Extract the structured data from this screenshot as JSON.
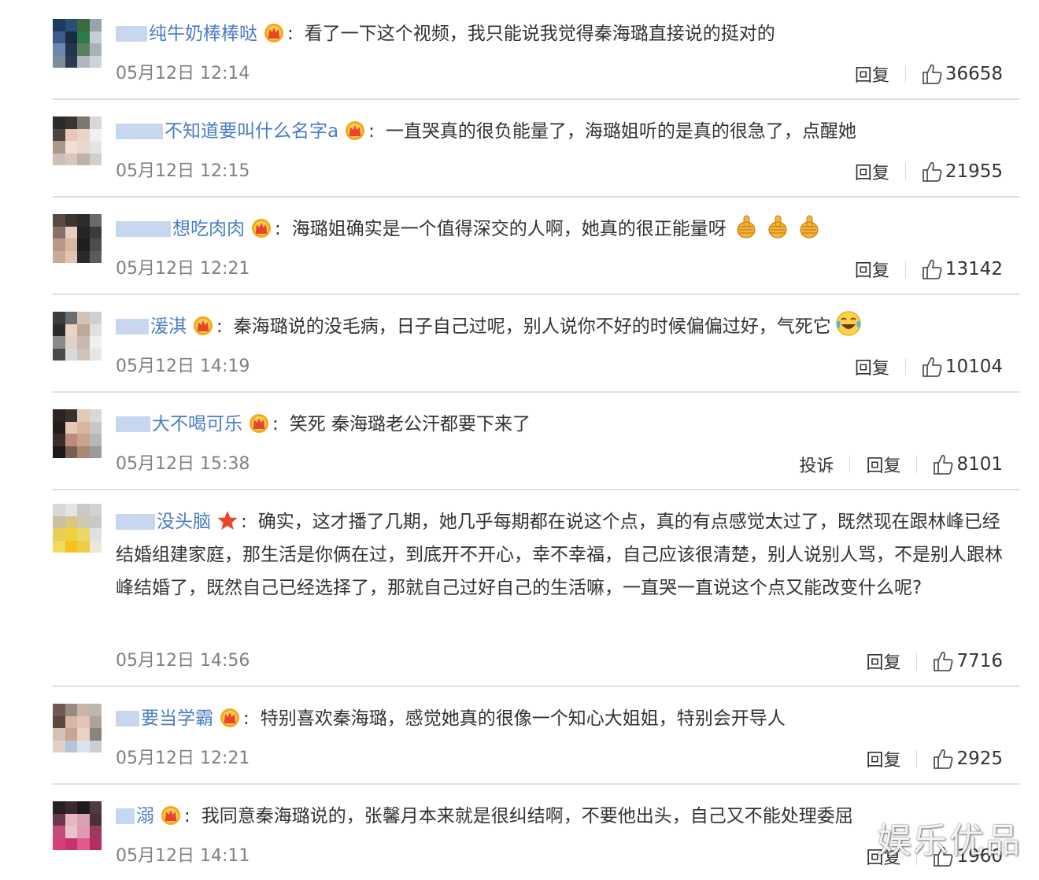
{
  "comments": [
    {
      "user": "纯牛奶棒棒哒",
      "badge": "crown",
      "text": "看了一下这个视频，我只能说我觉得秦海璐直接说的挺对的",
      "emojis": [],
      "time": "05月12日 12:14",
      "report": "",
      "reply": "回复",
      "likes": "36658"
    },
    {
      "user": "不知道要叫什么名字a",
      "badge": "crown",
      "text": "一直哭真的很负能量了，海璐姐听的是真的很急了，点醒她",
      "emojis": [],
      "time": "05月12日 12:15",
      "report": "",
      "reply": "回复",
      "likes": "21955"
    },
    {
      "user": "想吃肉肉",
      "badge": "crown",
      "text": "海璐姐确实是一个值得深交的人啊，她真的很正能量呀",
      "emojis": [
        "thumbs-up",
        "thumbs-up",
        "thumbs-up"
      ],
      "time": "05月12日 12:21",
      "report": "",
      "reply": "回复",
      "likes": "13142"
    },
    {
      "user": "湲淇",
      "badge": "crown",
      "text": "秦海璐说的没毛病，日子自己过呢，别人说你不好的时候偏偏过好，气死它",
      "emojis": [
        "laugh-cry"
      ],
      "time": "05月12日 14:19",
      "report": "",
      "reply": "回复",
      "likes": "10104"
    },
    {
      "user": "大不喝可乐",
      "badge": "crown",
      "text": "笑死 秦海璐老公汗都要下来了",
      "emojis": [],
      "time": "05月12日 15:38",
      "report": "投诉",
      "reply": "回复",
      "likes": "8101"
    },
    {
      "user": "没头脑",
      "badge": "star",
      "text": "确实，这才播了几期，她几乎每期都在说这个点，真的有点感觉太过了，既然现在跟林峰已经结婚组建家庭，那生活是你俩在过，到底开不开心，幸不幸福，自己应该很清楚，别人说别人骂，不是别人跟林峰结婚了，既然自己已经选择了，那就自己过好自己的生活嘛，一直哭一直说这个点又能改变什么呢?",
      "emojis": [],
      "time": "05月12日 14:56",
      "report": "",
      "reply": "回复",
      "likes": "7716"
    },
    {
      "user": "要当学霸",
      "badge": "crown",
      "text": "特别喜欢秦海璐，感觉她真的很像一个知心大姐姐，特别会开导人",
      "emojis": [],
      "time": "05月12日 12:21",
      "report": "",
      "reply": "回复",
      "likes": "2925"
    },
    {
      "user": "溺",
      "badge": "crown",
      "text": "我同意秦海璐说的，张馨月本来就是很纠结啊，不要他出头，自己又不能处理委屈",
      "emojis": [],
      "time": "05月12日 14:11",
      "report": "",
      "reply": "回复",
      "likes": "1960"
    }
  ],
  "colors": {
    "username": "#4a7cc4",
    "time": "#808080",
    "divider": "#dfdfdf"
  },
  "watermark": "娱乐优品"
}
